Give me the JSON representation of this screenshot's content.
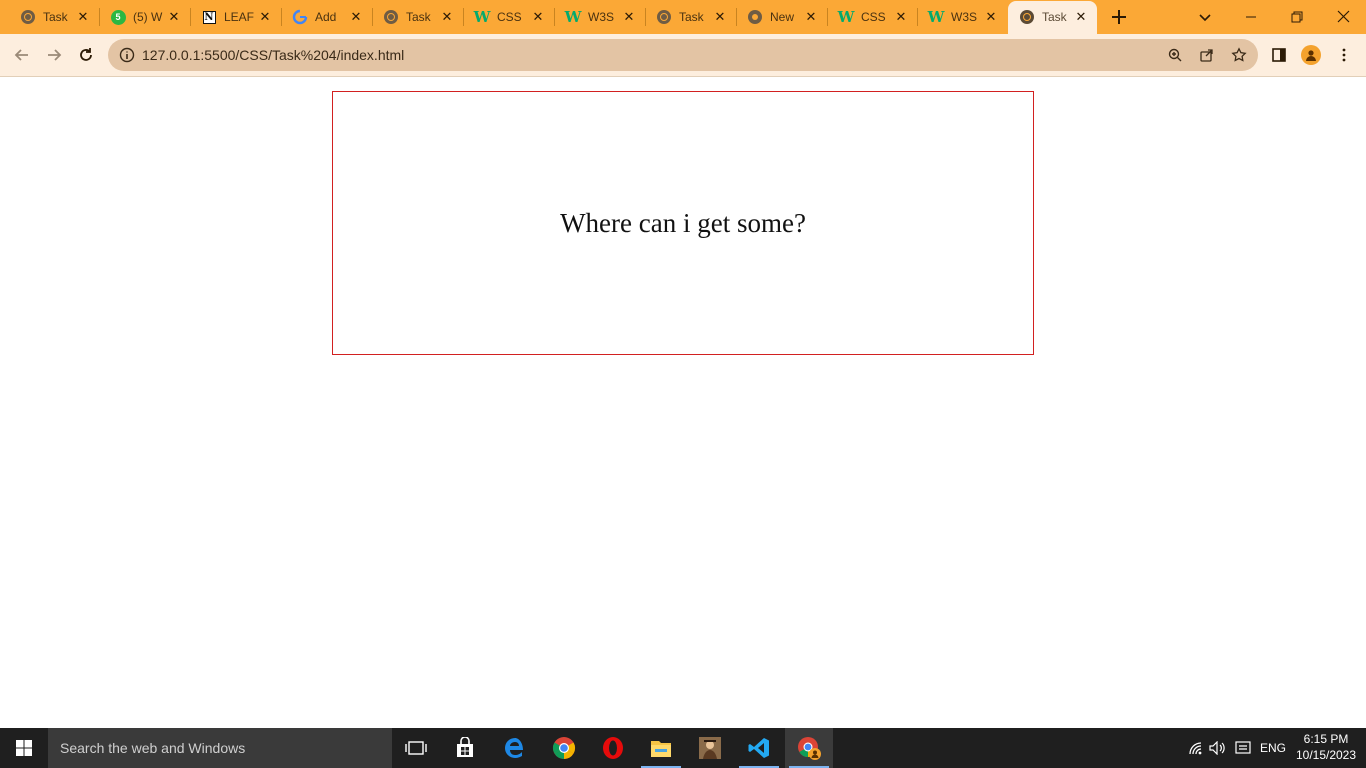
{
  "browser": {
    "tabs": [
      {
        "title": "Task",
        "icon": "globe-icon"
      },
      {
        "title": "(5) W",
        "icon": "whatsapp-icon"
      },
      {
        "title": "LEAF",
        "icon": "notion-icon"
      },
      {
        "title": "Add",
        "icon": "google-icon"
      },
      {
        "title": "Task",
        "icon": "globe-icon"
      },
      {
        "title": "CSS",
        "icon": "w3schools-icon"
      },
      {
        "title": "W3S",
        "icon": "w3schools-icon"
      },
      {
        "title": "Task",
        "icon": "globe-icon"
      },
      {
        "title": "New",
        "icon": "chrome-icon"
      },
      {
        "title": "CSS",
        "icon": "w3schools-icon"
      },
      {
        "title": "W3S",
        "icon": "w3schools-icon"
      },
      {
        "title": "Task",
        "icon": "globe-icon",
        "active": true
      }
    ],
    "url": "127.0.0.1:5500/CSS/Task%204/index.html",
    "colors": {
      "tab_strip": "#fba836",
      "toolbar": "#fdeede",
      "omnibox": "#e3c4a4"
    }
  },
  "page": {
    "box_text": "Where can i get some?",
    "box_border_color": "#d22020"
  },
  "taskbar": {
    "search_placeholder": "Search the web and Windows",
    "language": "ENG",
    "time": "6:15 PM",
    "date": "10/15/2023",
    "apps": [
      "task-view-icon",
      "store-icon",
      "edge-icon",
      "chrome-icon",
      "opera-icon",
      "file-explorer-icon",
      "game-icon",
      "vscode-icon",
      "chrome-profile-icon"
    ]
  }
}
